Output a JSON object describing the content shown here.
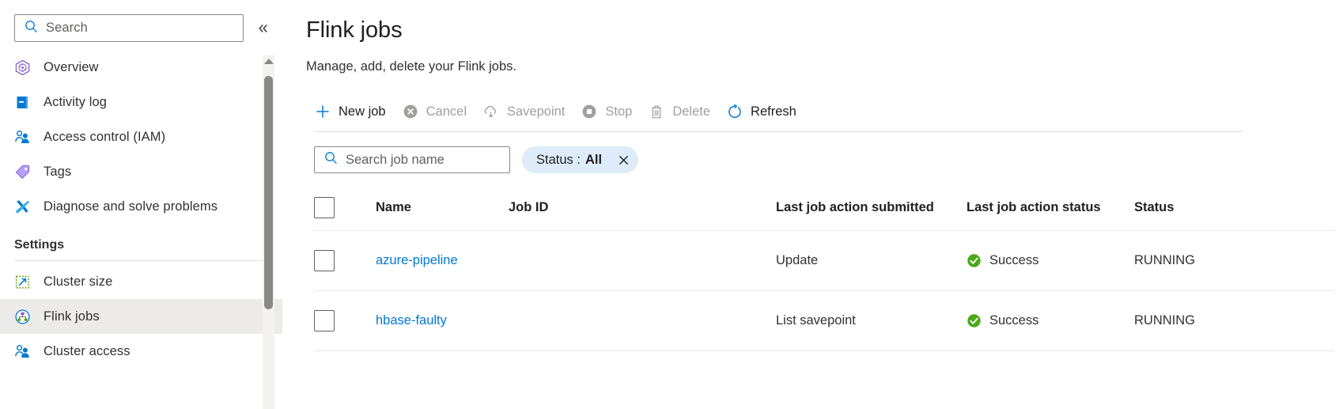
{
  "sidebar": {
    "search": {
      "placeholder": "Search",
      "icon": "search-icon"
    },
    "collapse": {
      "icon": "chevron-double-left-icon",
      "glyph": "«"
    },
    "items": [
      {
        "label": "Overview",
        "icon": "overview-icon"
      },
      {
        "label": "Activity log",
        "icon": "activity-log-icon"
      },
      {
        "label": "Access control (IAM)",
        "icon": "access-control-icon"
      },
      {
        "label": "Tags",
        "icon": "tags-icon"
      },
      {
        "label": "Diagnose and solve problems",
        "icon": "diagnose-icon"
      }
    ],
    "group": {
      "title": "Settings",
      "items": [
        {
          "label": "Cluster size",
          "icon": "cluster-size-icon",
          "selected": false
        },
        {
          "label": "Flink jobs",
          "icon": "flink-jobs-icon",
          "selected": true
        },
        {
          "label": "Cluster access",
          "icon": "cluster-access-icon",
          "selected": false
        }
      ]
    }
  },
  "main": {
    "title": "Flink jobs",
    "subtitle": "Manage, add, delete your Flink jobs.",
    "toolbar": [
      {
        "label": "New job",
        "icon": "plus-icon",
        "disabled": false
      },
      {
        "label": "Cancel",
        "icon": "cancel-icon",
        "disabled": true
      },
      {
        "label": "Savepoint",
        "icon": "cloud-savepoint-icon",
        "disabled": true
      },
      {
        "label": "Stop",
        "icon": "stop-icon",
        "disabled": true
      },
      {
        "label": "Delete",
        "icon": "trash-icon",
        "disabled": true
      },
      {
        "label": "Refresh",
        "icon": "refresh-icon",
        "disabled": false
      }
    ],
    "filters": {
      "job_search_placeholder": "Search job name",
      "job_search_icon": "search-icon",
      "status_filter": {
        "label": "Status :",
        "value": "All",
        "remove_icon": "close-icon",
        "background": "#deecf9"
      }
    },
    "table": {
      "columns": [
        "Name",
        "Job ID",
        "Last job action submitted",
        "Last job action status",
        "Status"
      ],
      "rows": [
        {
          "name": "azure-pipeline",
          "job_id": "",
          "last_action_submitted": "Update",
          "last_action_status": "Success",
          "last_action_status_icon": "success-check-icon",
          "status": "RUNNING"
        },
        {
          "name": "hbase-faulty",
          "job_id": "",
          "last_action_submitted": "List savepoint",
          "last_action_status": "Success",
          "last_action_status_icon": "success-check-icon",
          "status": "RUNNING"
        }
      ]
    }
  },
  "colors": {
    "accent_blue": "#0078d4",
    "link_blue": "#0078d4",
    "success_green": "#4aa916",
    "selected_row_bg": "#edebe9",
    "pill_bg": "#deecf9",
    "disabled_gray": "#a19f9d"
  }
}
